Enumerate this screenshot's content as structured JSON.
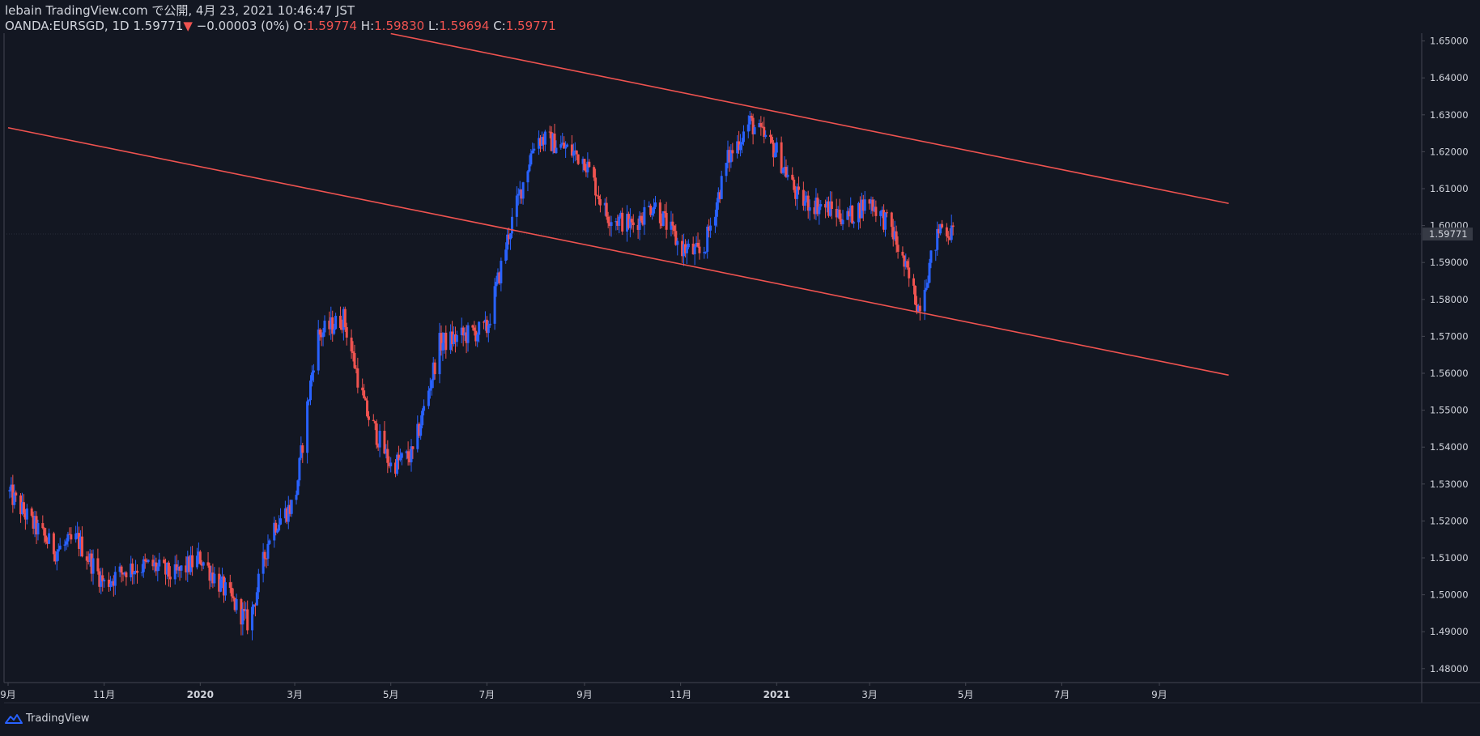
{
  "header": {
    "line1": "lebain TradingView.com で公開, 4月 23, 2021 10:46:47 JST",
    "symbol": "OANDA:EURSGD, 1D",
    "last": "1.59771",
    "arrow": "▼",
    "change": "−0.00003 (0%)",
    "o_label": "O:",
    "o_value": "1.59774",
    "h_label": "H:",
    "h_value": "1.59830",
    "l_label": "L:",
    "l_value": "1.59694",
    "c_label": "C:",
    "c_value": "1.59771"
  },
  "footer": {
    "brand": "TradingView",
    "icon": "tradingview-logo-icon"
  },
  "colors": {
    "background": "#131722",
    "up": "#2962ff",
    "down": "#ef5350",
    "trendline": "#ef5350",
    "price_badge": "#363a45"
  },
  "chart_data": {
    "type": "candlestick",
    "symbol": "OANDA:EURSGD",
    "interval": "1D",
    "ylim": [
      1.475,
      1.655
    ],
    "y_ticks": [
      "1.65000",
      "1.64000",
      "1.63000",
      "1.62000",
      "1.61000",
      "1.60000",
      "1.59000",
      "1.58000",
      "1.57000",
      "1.56000",
      "1.55000",
      "1.54000",
      "1.53000",
      "1.52000",
      "1.51000",
      "1.50000",
      "1.49000",
      "1.48000"
    ],
    "x_ticks": [
      "9月",
      "11月",
      "2020",
      "3月",
      "5月",
      "7月",
      "9月",
      "11月",
      "2021",
      "3月",
      "5月",
      "7月",
      "9月"
    ],
    "current_price": "1.59771",
    "grid": false,
    "trendlines": [
      {
        "from": [
          "2020-05-01",
          1.652
        ],
        "to": [
          "2021-10-15",
          1.606
        ]
      },
      {
        "from": [
          "2019-09-01",
          1.6265
        ],
        "to": [
          "2021-10-15",
          1.5595
        ]
      }
    ],
    "series": [
      {
        "close_anchors": [
          [
            "2019-09-01",
            1.528
          ],
          [
            "2019-09-15",
            1.52
          ],
          [
            "2019-10-01",
            1.512
          ],
          [
            "2019-10-15",
            1.515
          ],
          [
            "2019-11-01",
            1.503
          ],
          [
            "2019-11-15",
            1.507
          ],
          [
            "2019-12-01",
            1.508
          ],
          [
            "2019-12-15",
            1.505
          ],
          [
            "2020-01-01",
            1.51
          ],
          [
            "2020-01-15",
            1.502
          ],
          [
            "2020-02-01",
            1.492
          ],
          [
            "2020-02-15",
            1.518
          ],
          [
            "2020-03-01",
            1.525
          ],
          [
            "2020-03-15",
            1.57
          ],
          [
            "2020-04-01",
            1.575
          ],
          [
            "2020-04-15",
            1.55
          ],
          [
            "2020-05-01",
            1.535
          ],
          [
            "2020-05-15",
            1.538
          ],
          [
            "2020-06-01",
            1.568
          ],
          [
            "2020-06-15",
            1.57
          ],
          [
            "2020-07-01",
            1.572
          ],
          [
            "2020-07-15",
            1.598
          ],
          [
            "2020-08-01",
            1.624
          ],
          [
            "2020-08-15",
            1.622
          ],
          [
            "2020-09-01",
            1.618
          ],
          [
            "2020-09-15",
            1.603
          ],
          [
            "2020-10-01",
            1.6
          ],
          [
            "2020-10-15",
            1.606
          ],
          [
            "2020-11-01",
            1.594
          ],
          [
            "2020-11-15",
            1.592
          ],
          [
            "2020-12-01",
            1.618
          ],
          [
            "2020-12-15",
            1.628
          ],
          [
            "2021-01-01",
            1.62
          ],
          [
            "2021-01-15",
            1.607
          ],
          [
            "2021-02-01",
            1.605
          ],
          [
            "2021-02-15",
            1.602
          ],
          [
            "2021-03-01",
            1.607
          ],
          [
            "2021-03-15",
            1.599
          ],
          [
            "2021-04-01",
            1.578
          ],
          [
            "2021-04-15",
            1.6
          ],
          [
            "2021-04-23",
            1.5977
          ]
        ]
      }
    ]
  }
}
